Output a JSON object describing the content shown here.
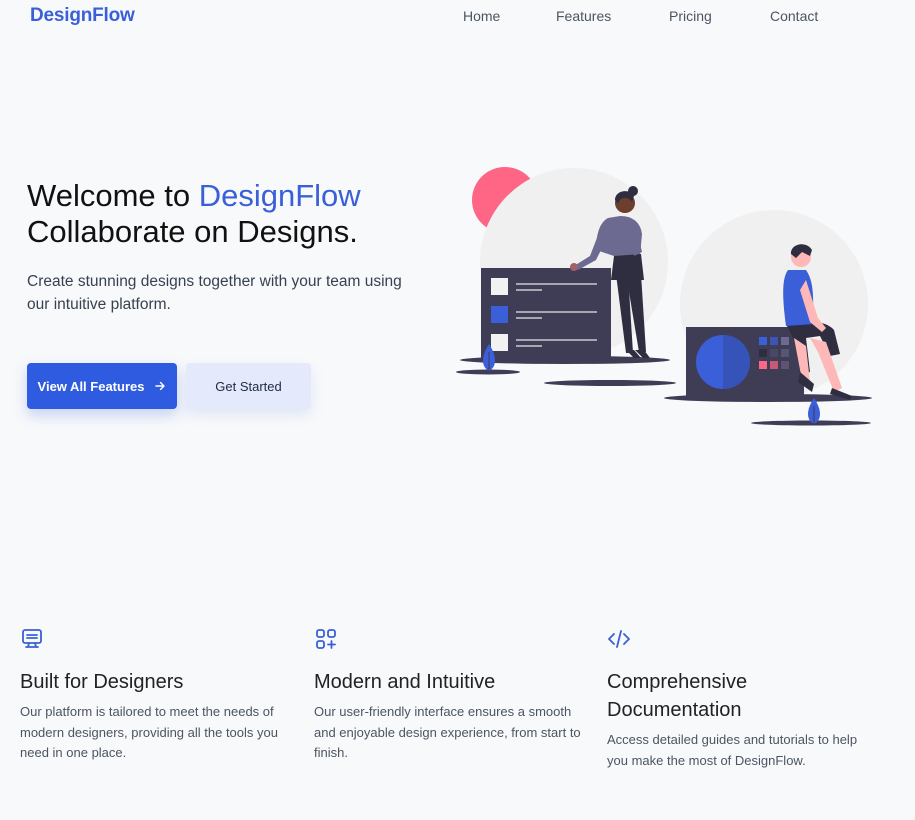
{
  "header": {
    "logo": "DesignFlow",
    "nav": [
      "Home",
      "Features",
      "Pricing",
      "Contact"
    ]
  },
  "hero": {
    "title_prefix": "Welcome to ",
    "title_brand": "DesignFlow",
    "title_line2": "Collaborate on Designs.",
    "subtitle": "Create stunning designs together with your team using our intuitive platform.",
    "primary_button": "View All Features",
    "primary_button_icon": "arrow-right-icon",
    "secondary_button": "Get Started"
  },
  "features": [
    {
      "icon": "monitor-icon",
      "title": "Built for Designers",
      "description": "Our platform is tailored to meet the needs of modern designers, providing all the tools you need in one place."
    },
    {
      "icon": "grid-plus-icon",
      "title": "Modern and Intuitive",
      "description": "Our user-friendly interface ensures a smooth and enjoyable design experience, from start to finish."
    },
    {
      "icon": "code-icon",
      "title": "Comprehensive Documentation",
      "description": "Access detailed guides and tutorials to help you make the most of DesignFlow."
    }
  ],
  "colors": {
    "brand": "#3b5fd9",
    "primary_button": "#2f5be0",
    "secondary_button": "#e4e9fb",
    "background": "#f8f9fa",
    "accent_pink": "#ff6584",
    "dark_panel": "#3f3d56"
  }
}
